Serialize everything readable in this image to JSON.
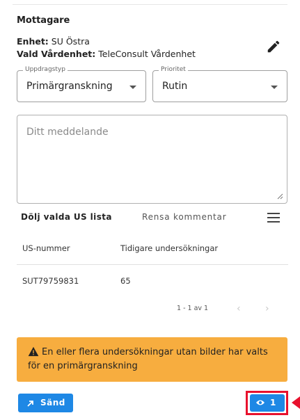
{
  "recipient": {
    "title": "Mottagare",
    "unit_label": "Enhet:",
    "unit_value": "SU Östra",
    "care_unit_label": "Vald Vårdenhet:",
    "care_unit_value": "TeleConsult Vårdenhet",
    "edit_icon": "pencil-icon"
  },
  "form": {
    "assignment_type": {
      "label": "Uppdragstyp",
      "value": "Primärgranskning"
    },
    "priority": {
      "label": "Prioritet",
      "value": "Rutin"
    },
    "message": {
      "placeholder": "Ditt meddelande",
      "value": ""
    }
  },
  "actions": {
    "hide_list": "Dölj valda US lista",
    "clear_comment": "Rensa kommentar",
    "menu_icon": "hamburger-menu-icon"
  },
  "table": {
    "columns": [
      "US-nummer",
      "Tidigare undersökningar"
    ],
    "rows": [
      [
        "SUT79759831",
        "65"
      ]
    ]
  },
  "pagination": {
    "range": "1 - 1 av 1",
    "prev_icon": "chevron-left-icon",
    "next_icon": "chevron-right-icon"
  },
  "warning": {
    "icon": "warning-triangle-icon",
    "text": "En eller flera undersökningar utan bilder har valts för en primärgranskning"
  },
  "footer": {
    "send_label": "Sänd",
    "send_icon": "send-arrow-icon",
    "view_count": "1",
    "view_icon": "eye-icon"
  },
  "colors": {
    "primary": "#1e88e5",
    "warning": "#f7ad3f",
    "highlight": "#e8112d"
  }
}
